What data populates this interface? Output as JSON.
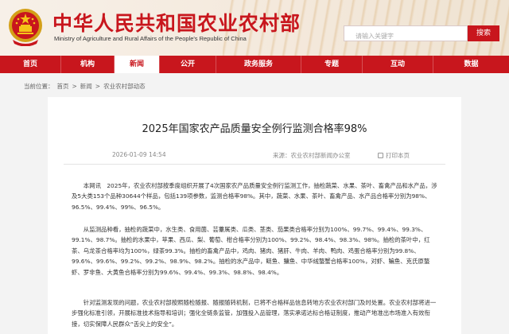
{
  "header": {
    "title": "中华人民共和国农业农村部",
    "subtitle": "Ministry of Agriculture and Rural Affairs of the People's Republic of China",
    "search_placeholder": "请输入关键字",
    "search_button": "搜索",
    "brand_color": "#c8161d"
  },
  "nav": {
    "items": [
      {
        "label": "首页",
        "active": false
      },
      {
        "label": "机构",
        "active": false
      },
      {
        "label": "新闻",
        "active": true
      },
      {
        "label": "公开",
        "active": false
      },
      {
        "label": "政务服务",
        "active": false
      },
      {
        "label": "专题",
        "active": false
      },
      {
        "label": "互动",
        "active": false
      },
      {
        "label": "数据",
        "active": false
      }
    ]
  },
  "breadcrumb": {
    "label": "当前位置：",
    "items": [
      "首页",
      "新闻",
      "农业农村部动态"
    ],
    "separator": ">"
  },
  "article": {
    "title": "2025年国家农产品质量安全例行监测合格率98%",
    "date": "2026-01-09 14:54",
    "source_label": "来源：",
    "source": "农业农村部新闻办公室",
    "print_label": "打印本页",
    "paragraphs": [
      "本网讯　2025年，农业农村部按季度组织开展了4次国家农产品质量安全例行监测工作，抽检蔬菜、水果、茶叶、畜禽产品和水产品，涉及5大类153个品种30644个样品，包括139项参数，监测合格率98%。其中，蔬菜、水果、茶叶、畜禽产品、水产品合格率分别为98%、96.5%、99.4%、99%、96.5%。",
      "从监测品种看，抽检的蔬菜中，水生类、食用菌、芸薹属类、瓜类、茎类、茄果类合格率分别为100%、99.7%、99.4%、99.3%、99.1%、98.7%。抽检的水果中，苹果、西瓜、梨、葡萄、柑合格率分别为100%、99.2%、98.4%、98.3%、98%。抽检的茶叶中，红茶、乌龙茶合格率均为100%，绿茶99.3%。抽检的畜禽产品中，鸡肉、猪肉、猪肝、牛肉、羊肉、鸭肉、鸡蛋合格率分别为99.8%、99.6%、99.6%、99.2%、99.2%、98.9%、98.2%。抽检的水产品中，鲢鱼、鳙鱼、中华绒螯蟹合格率100%，对虾、鳊鱼、克氏原螯虾、罗非鱼、大黄鱼合格率分别为99.6%、99.4%、99.3%、98.8%、98.4%。",
      "针对监测发现的问题，农业农村部按照随检随报、随报随转机制，已将不合格样品信息转地方农业农村部门及时处置。农业农村部将进一步强化标准引领，开展标准技术指导和培训；强化全链条监管，加强投入品管理，落实承诺达标合格证制度，推动产地准出市场准入有效衔接，切实保障人民群众“舌尖上的安全”。"
    ]
  }
}
